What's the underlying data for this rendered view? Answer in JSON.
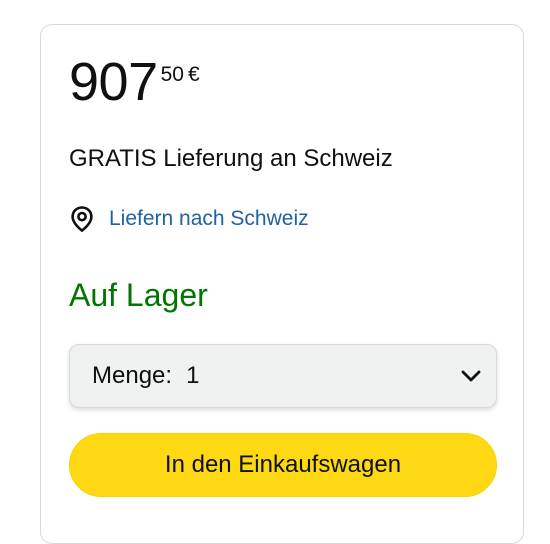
{
  "price": {
    "whole": "907",
    "fraction": "50",
    "currency": "€"
  },
  "delivery": {
    "text": "GRATIS Lieferung an Schweiz"
  },
  "location": {
    "icon": "location-pin-icon",
    "link_text": "Liefern nach Schweiz"
  },
  "availability": {
    "text": "Auf Lager",
    "color": "#007600"
  },
  "quantity": {
    "label": "Menge:",
    "value": "1",
    "icon": "chevron-down-icon"
  },
  "add_to_cart": {
    "label": "In den Einkaufswagen",
    "color": "#ffd814"
  },
  "colors": {
    "link": "#2162a1",
    "text": "#0f1111",
    "border": "#d5d9d9"
  }
}
